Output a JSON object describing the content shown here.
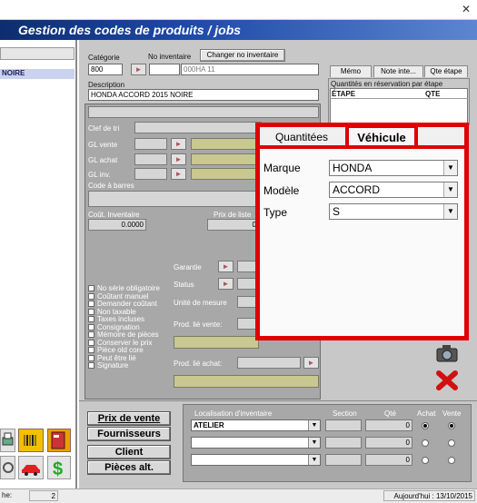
{
  "window": {
    "close_glyph": "✕"
  },
  "banner": {
    "title": "Gestion des codes de produits / jobs"
  },
  "left": {
    "selected_item": "NOIRE"
  },
  "form": {
    "categorie_label": "Catégorie",
    "categorie_value": "800",
    "no_inventaire_label": "No inventaire",
    "change_inventaire_button": "Changer no inventaire",
    "no_inventaire_value": "000HA 11",
    "description_label": "Description",
    "description_value": "HONDA ACCORD 2015 NOIRE",
    "clef_tri_label": "Clef de tri",
    "gl_vente_label": "GL vente",
    "gl_achat_label": "GL achat",
    "gl_inv_label": "GL inv.",
    "code_barres_label": "Code à barres",
    "cout_inventaire_label": "Coût. Inventaire",
    "cout_inventaire_value": "0.0000",
    "prix_liste_label": "Prix de liste",
    "prix_liste_value": "0",
    "garantie_label": "Garantie",
    "status_label": "Status",
    "unite_mesure_label": "Unité de mesure",
    "prod_lie_vente_label": "Prod. lié vente:",
    "prod_lie_achat_label": "Prod. lié achat:"
  },
  "right_tabs": {
    "memo": "Mémo",
    "note_inte": "Note inte...",
    "qte_etape": "Qte étape",
    "reservation_label": "Quantités en réservation par étape",
    "col_etape": "ÉTAPE",
    "col_qte": "QTE"
  },
  "checkboxes": [
    "No série obligatoire",
    "Coûtant manuel",
    "Demander coûtant",
    "Non taxable",
    "Taxes incluses",
    "Consignation",
    "Mémoire de pièces",
    "Conserver le prix",
    "Pièce old core",
    "Peut être lié",
    "Signature"
  ],
  "popup": {
    "tab_quantites": "Quantitées",
    "tab_vehicule": "Véhicule",
    "marque_label": "Marque",
    "marque_value": "HONDA",
    "modele_label": "Modèle",
    "modele_value": "ACCORD",
    "type_label": "Type",
    "type_value": "S"
  },
  "bottom_buttons": {
    "prix_vente": "Prix de vente",
    "fournisseurs": "Fournisseurs",
    "client": "Client",
    "pieces_alt": "Pièces alt."
  },
  "localisation": {
    "header_localisation": "Localisation d'inventaire",
    "header_section": "Section",
    "header_qte": "Qté",
    "header_achat": "Achat",
    "header_vente": "Vente",
    "rows": [
      {
        "location": "ATELIER",
        "qte": "0"
      },
      {
        "location": "",
        "qte": "0"
      },
      {
        "location": "",
        "qte": "0"
      }
    ]
  },
  "statusbar": {
    "left_label": "he:",
    "count": "2",
    "today": "Aujourd'hui : 13/10/2015"
  },
  "colors": {
    "highlight_red": "#e00000",
    "banner_blue": "#1e4aa8"
  }
}
